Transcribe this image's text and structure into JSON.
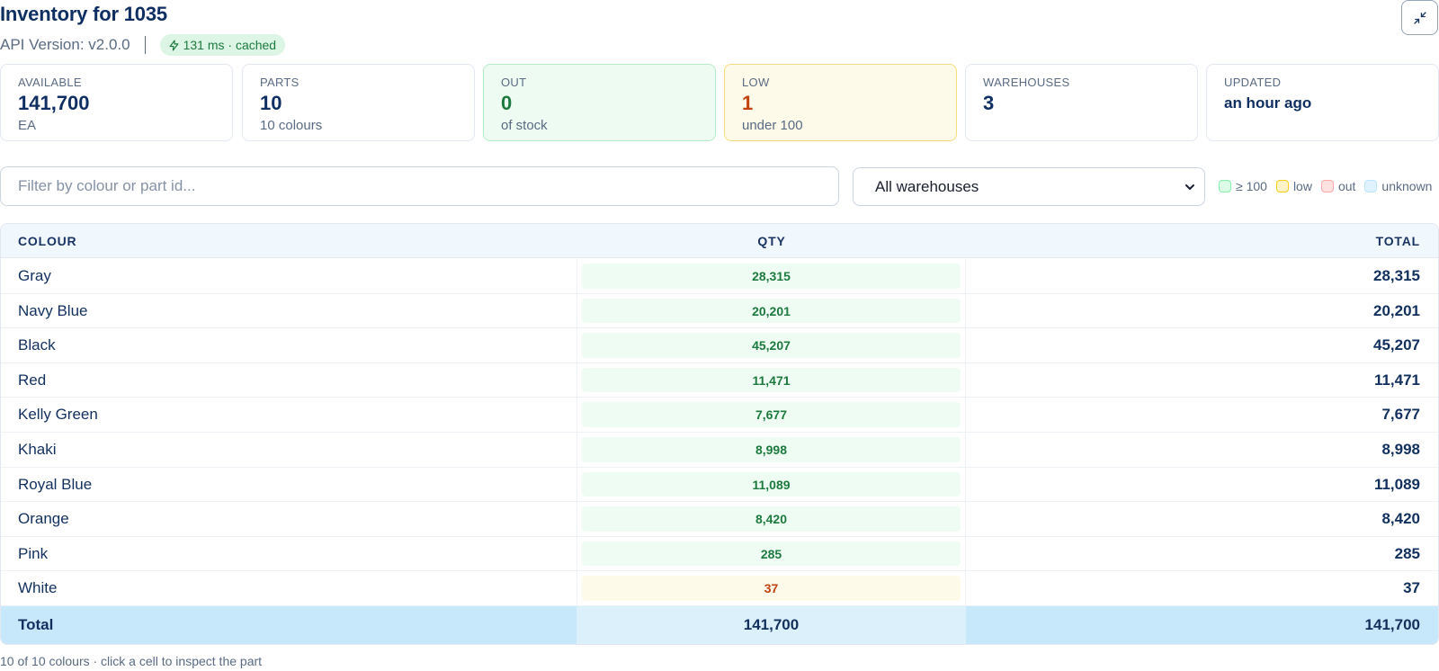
{
  "header": {
    "title": "Inventory for 1035",
    "api_version": "API Version: v2.0.0",
    "timing_badge": "131 ms · cached"
  },
  "stats": [
    {
      "label": "AVAILABLE",
      "value": "141,700",
      "sub": "EA",
      "tone": "default"
    },
    {
      "label": "PARTS",
      "value": "10",
      "sub": "10 colours",
      "tone": "default"
    },
    {
      "label": "OUT",
      "value": "0",
      "sub": "of stock",
      "tone": "green"
    },
    {
      "label": "LOW",
      "value": "1",
      "sub": "under 100",
      "tone": "amber"
    },
    {
      "label": "WAREHOUSES",
      "value": "3",
      "sub": "",
      "tone": "default"
    },
    {
      "label": "UPDATED",
      "value": "an hour ago",
      "sub": "",
      "tone": "default"
    }
  ],
  "filter": {
    "placeholder": "Filter by colour or part id...",
    "value": ""
  },
  "warehouse_select": {
    "selected": "All warehouses"
  },
  "legend": [
    {
      "label": "≥ 100",
      "status": "ok"
    },
    {
      "label": "low",
      "status": "low"
    },
    {
      "label": "out",
      "status": "out"
    },
    {
      "label": "unknown",
      "status": "unknown"
    }
  ],
  "table": {
    "columns": [
      "COLOUR",
      "QTY",
      "TOTAL"
    ],
    "rows": [
      {
        "colour": "Gray",
        "qty": "28,315",
        "total": "28,315",
        "status": "ok"
      },
      {
        "colour": "Navy Blue",
        "qty": "20,201",
        "total": "20,201",
        "status": "ok"
      },
      {
        "colour": "Black",
        "qty": "45,207",
        "total": "45,207",
        "status": "ok"
      },
      {
        "colour": "Red",
        "qty": "11,471",
        "total": "11,471",
        "status": "ok"
      },
      {
        "colour": "Kelly Green",
        "qty": "7,677",
        "total": "7,677",
        "status": "ok"
      },
      {
        "colour": "Khaki",
        "qty": "8,998",
        "total": "8,998",
        "status": "ok"
      },
      {
        "colour": "Royal Blue",
        "qty": "11,089",
        "total": "11,089",
        "status": "ok"
      },
      {
        "colour": "Orange",
        "qty": "8,420",
        "total": "8,420",
        "status": "ok"
      },
      {
        "colour": "Pink",
        "qty": "285",
        "total": "285",
        "status": "ok"
      },
      {
        "colour": "White",
        "qty": "37",
        "total": "37",
        "status": "low"
      }
    ],
    "footer": {
      "label": "Total",
      "qty": "141,700",
      "total": "141,700"
    }
  },
  "footnote": "10 of 10 colours · click a cell to inspect the part",
  "colors": {
    "primary_text": "#12305e",
    "ok_bg": "#effcf3",
    "ok_text": "#1d7a3f",
    "low_bg": "#fefaea",
    "low_text": "#c2410c",
    "total_row_bg": "#c7e7fb"
  },
  "icons": {
    "timing": "lightning-icon",
    "collapse": "collapse-icon",
    "select": "chevron-down-icon"
  }
}
